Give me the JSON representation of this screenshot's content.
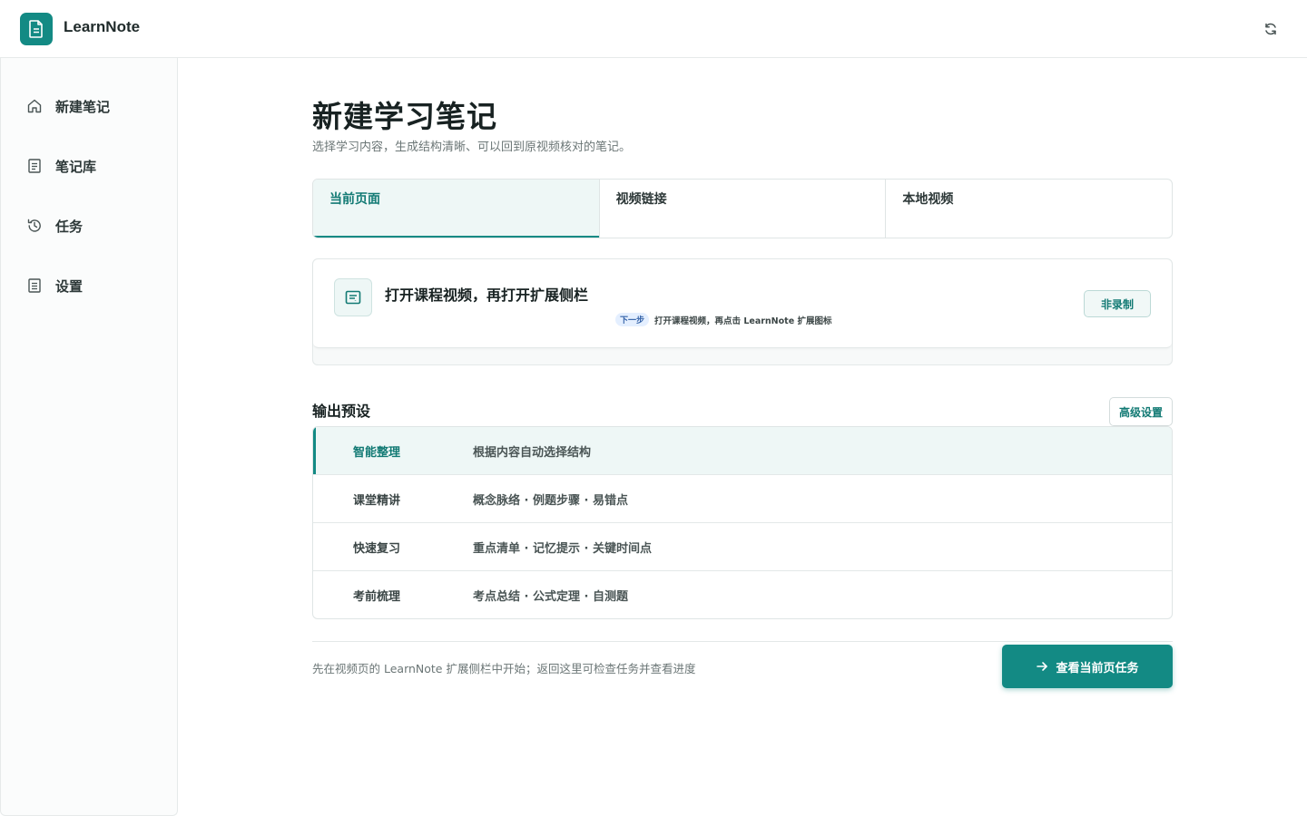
{
  "header": {
    "brand": "LearnNote",
    "logo_icon": "document-icon",
    "refresh_icon": "refresh-icon"
  },
  "sidebar": {
    "items": [
      {
        "label": "新建笔记",
        "icon": "home-icon"
      },
      {
        "label": "笔记库",
        "icon": "notebook-icon"
      },
      {
        "label": "任务",
        "icon": "history-icon"
      },
      {
        "label": "设置",
        "icon": "settings-doc-icon"
      }
    ]
  },
  "main": {
    "title": "新建学习笔记",
    "subtitle": "选择学习内容，生成结构清晰、可以回到原视频核对的笔记。",
    "tabs": [
      {
        "label": "当前页面",
        "active": true
      },
      {
        "label": "视频链接",
        "active": false
      },
      {
        "label": "本地视频",
        "active": false
      }
    ],
    "info_card": {
      "title": "打开课程视频，再打开扩展侧栏",
      "next_badge": "下一步",
      "next_text": "打开课程视频，再点击 LearnNote 扩展图标",
      "record_button": "非录制"
    },
    "presets": {
      "title": "输出预设",
      "advanced_button": "高级设置",
      "items": [
        {
          "name": "智能整理",
          "desc": "根据内容自动选择结构",
          "active": true
        },
        {
          "name": "课堂精讲",
          "desc": "概念脉络 · 例题步骤 · 易错点",
          "active": false
        },
        {
          "name": "快速复习",
          "desc": "重点清单 · 记忆提示 · 关键时间点",
          "active": false
        },
        {
          "name": "考前梳理",
          "desc": "考点总结 · 公式定理 · 自测题",
          "active": false
        }
      ]
    },
    "footer": {
      "hint": "先在视频页的 LearnNote 扩展侧栏中开始；返回这里可检查任务并查看进度",
      "primary_button": "查看当前页任务"
    }
  },
  "colors": {
    "accent": "#138a84",
    "accent_light": "#eef7f6"
  }
}
